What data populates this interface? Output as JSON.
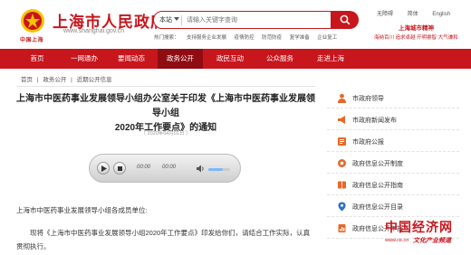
{
  "header": {
    "site_name": "上海市人民政府",
    "site_url": "www.shanghai.gov.cn",
    "emblem_caption": "中国上海",
    "search_scope": "本站",
    "search_placeholder": "请输入关键字查询",
    "hot_links": [
      "热门搜索：",
      "支持服务企业发展",
      "疫情防控",
      "防范防疫",
      "复学准备",
      "企业复工"
    ],
    "top_links": [
      "无障碍",
      "简体",
      "English"
    ],
    "spirit_link": "上海城市精神",
    "weather": "海纳百川 追求卓越 开明睿智 大气谦和"
  },
  "nav": {
    "items": [
      "首页",
      "一网通办",
      "要闻动态",
      "政务公开",
      "政民互动",
      "公众服务",
      "走进上海"
    ],
    "active_index": 3
  },
  "breadcrumb": [
    "首页",
    "政务公开",
    "近期公开信息"
  ],
  "article": {
    "title_line1": "上海市中医药事业发展领导小组办公室关于印发《上海市中医药事业发展领导小组",
    "title_line2": "2020年工作要点》的通知",
    "date": "（ 2020年04月01日 ）",
    "salutation": "上海市中医药事业发展领导小组各成员单位:",
    "body": "现将《上海市中医药事业发展领导小组2020年工作要点》印发给你们，请结合工作实际，认真贯彻执行。"
  },
  "player": {
    "current_time": "00:00",
    "duration": "00:00",
    "volume": 0.65
  },
  "sidebar": {
    "items": [
      {
        "label": "市政府领导",
        "icon": "person-icon",
        "color": "#e8682a"
      },
      {
        "label": "市政府新闻发布",
        "icon": "megaphone-icon",
        "color": "#e8682a"
      },
      {
        "label": "市政府公报",
        "icon": "bulletin-icon",
        "color": "#e8682a"
      },
      {
        "label": "政府信息公开制度",
        "icon": "gear-icon",
        "color": "#e8682a"
      },
      {
        "label": "政府信息公开指南",
        "icon": "book-icon",
        "color": "#e8682a"
      },
      {
        "label": "政府信息公开目录",
        "icon": "location-icon",
        "color": "#2b70c9"
      },
      {
        "label": "政府信息公开年报",
        "icon": "report-icon",
        "color": "#e8682a"
      }
    ]
  },
  "watermark": {
    "title": "中国经济网",
    "url": "www.ce.cn",
    "subtitle": "文化产业频道"
  },
  "colors": {
    "brand_red": "#c8161d",
    "nav_active": "#8f0d12",
    "sidebar_icon": "#e8682a"
  }
}
